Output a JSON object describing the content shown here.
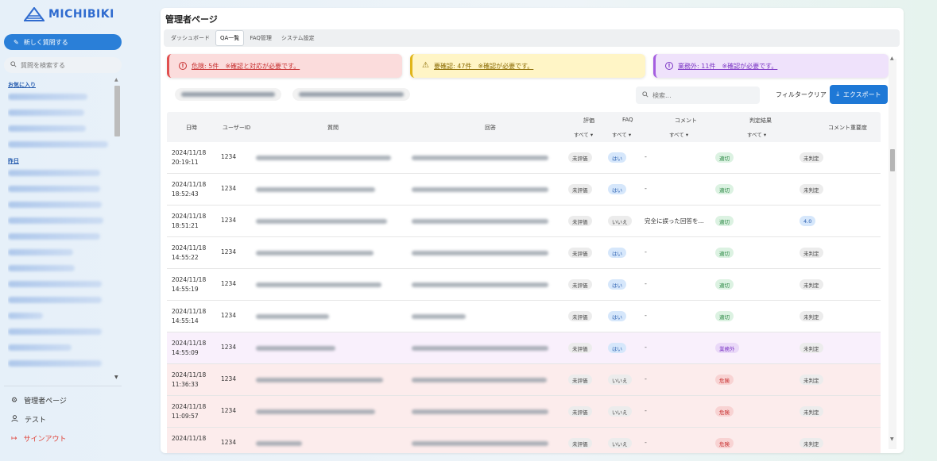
{
  "brand": {
    "name": "MICHIBIKI",
    "color": "#2f6bcf"
  },
  "sidebar": {
    "new_question": "新しく質問する",
    "search_placeholder": "質問を検索する",
    "section_favorites": "お気に入り",
    "section_yesterday": "昨日",
    "favorites_count": 4,
    "yesterday_count": 13,
    "nav": [
      {
        "icon": "gear-icon",
        "label": "管理者ページ"
      },
      {
        "icon": "user-icon",
        "label": "テスト"
      },
      {
        "icon": "signout-icon",
        "label": "サインアウト"
      }
    ]
  },
  "page": {
    "title": "管理者ページ",
    "tabs": [
      "ダッシュボード",
      "QA一覧",
      "FAQ管理",
      "システム設定"
    ],
    "active_tab": "QA一覧"
  },
  "alerts": {
    "danger": "危険: 5件　※確認と対応が必要です。",
    "warn": "要確認: 47件　※確認が必要です。",
    "out": "業務外: 11件　※確認が必要です。"
  },
  "toolbar": {
    "search_placeholder": "検索...",
    "filter_clear": "フィルタークリア",
    "export": "エクスポート"
  },
  "table": {
    "headers": {
      "date": "日時",
      "user": "ユーザーID",
      "question": "質問",
      "answer": "回答",
      "rating": "評価",
      "faq": "FAQ",
      "comment": "コメント",
      "judgement": "判定結果",
      "importance": "コメント重要度"
    },
    "filter_all": "すべて",
    "rows": [
      {
        "date": "2024/11/18",
        "time": "20:19:11",
        "user": "1234",
        "rating": "未評価",
        "faq": "はい",
        "comment": "-",
        "judgement": "適切",
        "judge_type": "green",
        "importance": "未判定",
        "imp_type": "gray",
        "row_type": ""
      },
      {
        "date": "2024/11/18",
        "time": "18:52:43",
        "user": "1234",
        "rating": "未評価",
        "faq": "はい",
        "comment": "-",
        "judgement": "適切",
        "judge_type": "green",
        "importance": "未判定",
        "imp_type": "gray",
        "row_type": ""
      },
      {
        "date": "2024/11/18",
        "time": "18:51:21",
        "user": "1234",
        "rating": "未評価",
        "faq": "いいえ",
        "comment": "完全に誤った回答を...",
        "judgement": "適切",
        "judge_type": "green",
        "importance": "4.0",
        "imp_type": "blue",
        "row_type": ""
      },
      {
        "date": "2024/11/18",
        "time": "14:55:22",
        "user": "1234",
        "rating": "未評価",
        "faq": "はい",
        "comment": "-",
        "judgement": "適切",
        "judge_type": "green",
        "importance": "未判定",
        "imp_type": "gray",
        "row_type": ""
      },
      {
        "date": "2024/11/18",
        "time": "14:55:19",
        "user": "1234",
        "rating": "未評価",
        "faq": "はい",
        "comment": "-",
        "judgement": "適切",
        "judge_type": "green",
        "importance": "未判定",
        "imp_type": "gray",
        "row_type": ""
      },
      {
        "date": "2024/11/18",
        "time": "14:55:14",
        "user": "1234",
        "rating": "未評価",
        "faq": "はい",
        "comment": "-",
        "judgement": "適切",
        "judge_type": "green",
        "importance": "未判定",
        "imp_type": "gray",
        "row_type": ""
      },
      {
        "date": "2024/11/18",
        "time": "14:55:09",
        "user": "1234",
        "rating": "未評価",
        "faq": "はい",
        "comment": "-",
        "judgement": "業務外",
        "judge_type": "purple",
        "importance": "未判定",
        "imp_type": "gray",
        "row_type": "out"
      },
      {
        "date": "2024/11/18",
        "time": "11:36:33",
        "user": "1234",
        "rating": "未評価",
        "faq": "いいえ",
        "comment": "-",
        "judgement": "危険",
        "judge_type": "red",
        "importance": "未判定",
        "imp_type": "gray",
        "row_type": "danger"
      },
      {
        "date": "2024/11/18",
        "time": "11:09:57",
        "user": "1234",
        "rating": "未評価",
        "faq": "いいえ",
        "comment": "-",
        "judgement": "危険",
        "judge_type": "red",
        "importance": "未判定",
        "imp_type": "gray",
        "row_type": "danger"
      },
      {
        "date": "2024/11/18",
        "time": "",
        "user": "1234",
        "rating": "未評価",
        "faq": "いいえ",
        "comment": "-",
        "judgement": "危険",
        "judge_type": "red",
        "importance": "未判定",
        "imp_type": "gray",
        "row_type": "danger"
      }
    ]
  }
}
